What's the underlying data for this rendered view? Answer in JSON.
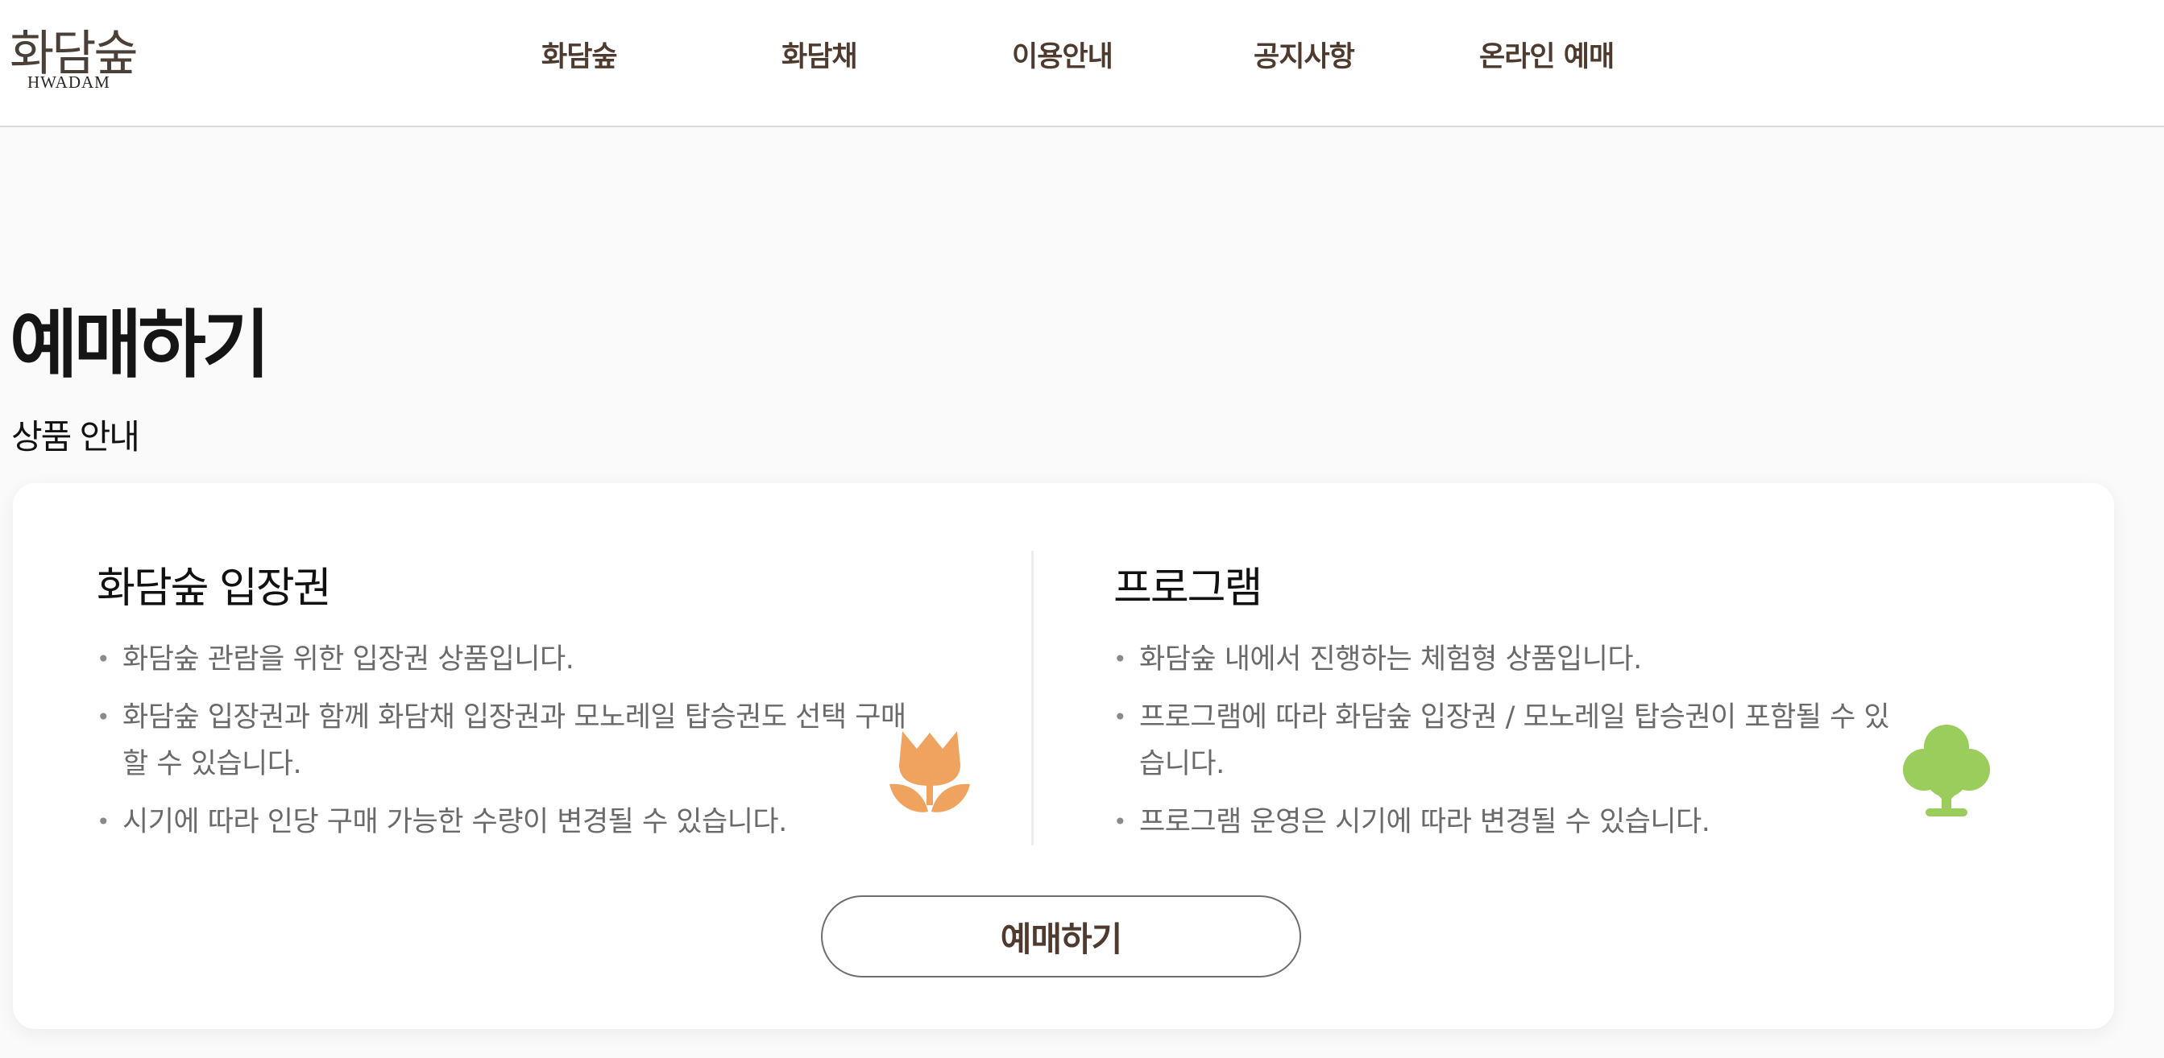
{
  "header": {
    "logo": {
      "text_ko": "화담숲",
      "text_en": "HWADAM"
    },
    "nav": [
      {
        "label": "화담숲"
      },
      {
        "label": "화담채"
      },
      {
        "label": "이용안내"
      },
      {
        "label": "공지사항"
      },
      {
        "label": "온라인 예매"
      }
    ]
  },
  "main": {
    "page_title": "예매하기",
    "section_title": "상품 안내",
    "products": [
      {
        "title": "화담숲 입장권",
        "icon": "tulip-icon",
        "bullets": [
          "화담숲 관람을 위한 입장권 상품입니다.",
          "화담숲 입장권과 함께 화담채 입장권과 모노레일 탑승권도 선택 구매할 수 있습니다.",
          "시기에 따라 인당 구매 가능한 수량이 변경될 수 있습니다."
        ]
      },
      {
        "title": "프로그램",
        "icon": "tree-icon",
        "bullets": [
          "화담숲 내에서 진행하는 체험형 상품입니다.",
          "프로그램에 따라 화담숲 입장권 / 모노레일 탑승권이 포함될 수 있습니다.",
          "프로그램 운영은 시기에 따라 변경될 수 있습니다."
        ]
      }
    ],
    "book_button": "예매하기"
  },
  "colors": {
    "nav_text": "#4e3a2e",
    "tulip": "#f0a35e",
    "tree": "#9acd5c",
    "bullet_text": "#6a6a6a"
  }
}
